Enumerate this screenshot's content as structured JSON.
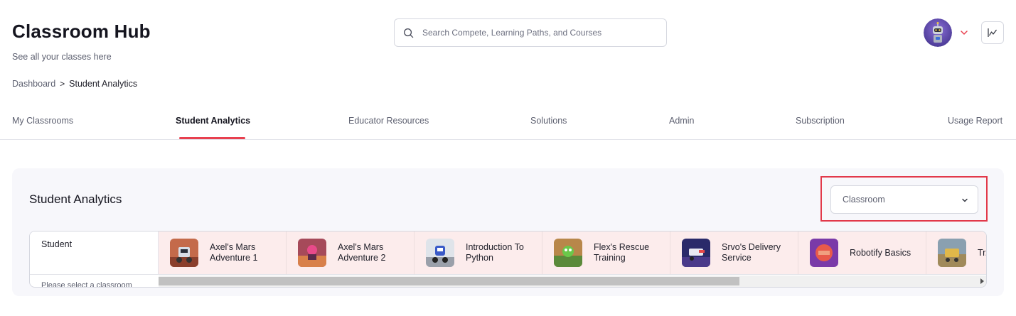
{
  "header": {
    "title": "Classroom Hub",
    "subtitle": "See all your classes here"
  },
  "breadcrumb": {
    "parent": "Dashboard",
    "separator": ">",
    "current": "Student Analytics"
  },
  "search": {
    "placeholder": "Search Compete, Learning Paths, and Courses",
    "icon": "search-icon"
  },
  "user": {
    "avatar_icon": "robot-avatar",
    "menu_icon": "chevron-down-icon",
    "chart_icon": "line-chart-icon"
  },
  "tabs": [
    {
      "label": "My Classrooms",
      "active": false
    },
    {
      "label": "Student Analytics",
      "active": true
    },
    {
      "label": "Educator Resources",
      "active": false
    },
    {
      "label": "Solutions",
      "active": false
    },
    {
      "label": "Admin",
      "active": false
    },
    {
      "label": "Subscription",
      "active": false
    },
    {
      "label": "Usage Report",
      "active": false
    }
  ],
  "panel": {
    "title": "Student Analytics",
    "select_value": "Classroom",
    "highlight_color": "#e2394a"
  },
  "table": {
    "student_header": "Student",
    "empty_message": "Please select a classroom",
    "courses": [
      {
        "name": "Axel's Mars Adventure 1"
      },
      {
        "name": "Axel's Mars Adventure 2"
      },
      {
        "name": "Introduction To Python"
      },
      {
        "name": "Flex's Rescue Training"
      },
      {
        "name": "Srvo's Delivery Service"
      },
      {
        "name": "Robotify Basics"
      },
      {
        "name": "Tr... Hu..."
      }
    ]
  },
  "colors": {
    "accent": "#e8404f",
    "course_cell_bg": "#fcecec",
    "panel_bg": "#f7f7fb"
  }
}
